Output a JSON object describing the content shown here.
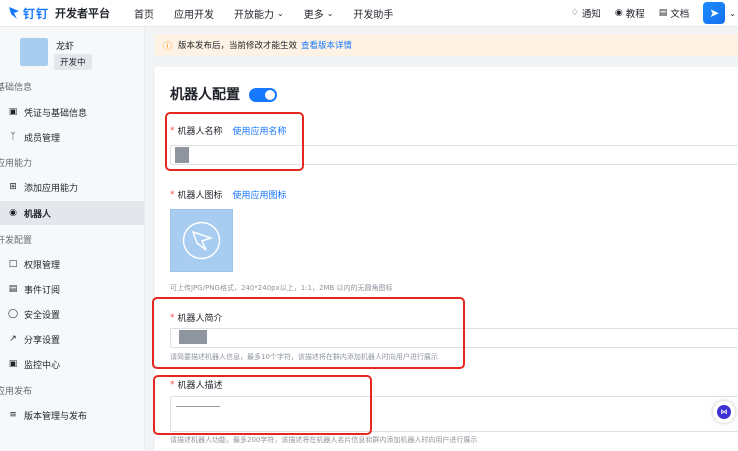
{
  "topbar": {
    "brand": "钉钉",
    "title": "开发者平台",
    "nav": [
      {
        "label": "首页",
        "dropdown": false
      },
      {
        "label": "应用开发",
        "dropdown": false
      },
      {
        "label": "开放能力",
        "dropdown": true
      },
      {
        "label": "更多",
        "dropdown": true
      },
      {
        "label": "开发助手",
        "dropdown": false
      }
    ],
    "right": [
      {
        "label": "通知",
        "icon": "bell-icon"
      },
      {
        "label": "教程",
        "icon": "map-pin-icon"
      },
      {
        "label": "文档",
        "icon": "book-icon"
      }
    ]
  },
  "sidebar": {
    "app_name": "龙虾",
    "app_status": "开发中",
    "sections": [
      {
        "label": "基础信息",
        "items": [
          {
            "label": "凭证与基础信息",
            "icon": "credential-icon",
            "active": false
          },
          {
            "label": "成员管理",
            "icon": "user-icon",
            "active": false
          }
        ]
      },
      {
        "label": "应用能力",
        "items": [
          {
            "label": "添加应用能力",
            "icon": "grid-add-icon",
            "active": false
          },
          {
            "label": "机器人",
            "icon": "robot-icon",
            "active": true
          }
        ]
      },
      {
        "label": "开发配置",
        "items": [
          {
            "label": "权限管理",
            "icon": "lock-icon",
            "active": false
          },
          {
            "label": "事件订阅",
            "icon": "event-icon",
            "active": false
          },
          {
            "label": "安全设置",
            "icon": "shield-icon",
            "active": false
          },
          {
            "label": "分享设置",
            "icon": "share-icon",
            "active": false
          },
          {
            "label": "监控中心",
            "icon": "monitor-icon",
            "active": false
          }
        ]
      },
      {
        "label": "应用发布",
        "items": [
          {
            "label": "版本管理与发布",
            "icon": "layers-icon",
            "active": false
          }
        ]
      }
    ]
  },
  "notice": {
    "text": "版本发布后，当前修改才能生效",
    "link": "查看版本详情"
  },
  "form": {
    "title": "机器人配置",
    "enabled": true,
    "name_label": "机器人名称",
    "name_link": "使用应用名称",
    "icon_label": "机器人图标",
    "icon_link": "使用应用图标",
    "icon_hint": "可上传JPG/PNG格式，240*240px以上，1:1，2MB 以内的无圆角图标",
    "intro_label": "机器人简介",
    "intro_hint": "请简要描述机器人信息，最多10个字符，该描述将在群内添加机器人时向用户进行展示",
    "desc_label": "机器人描述",
    "desc_hint": "请描述机器人功能，最多200字符，该描述将在机器人名片信息和群内添加机器人时向用户进行展示"
  },
  "colors": {
    "accent": "#1677ff",
    "required": "#f54a45",
    "highlight": "#e5281f",
    "notice_bg": "#fdf2e4"
  }
}
